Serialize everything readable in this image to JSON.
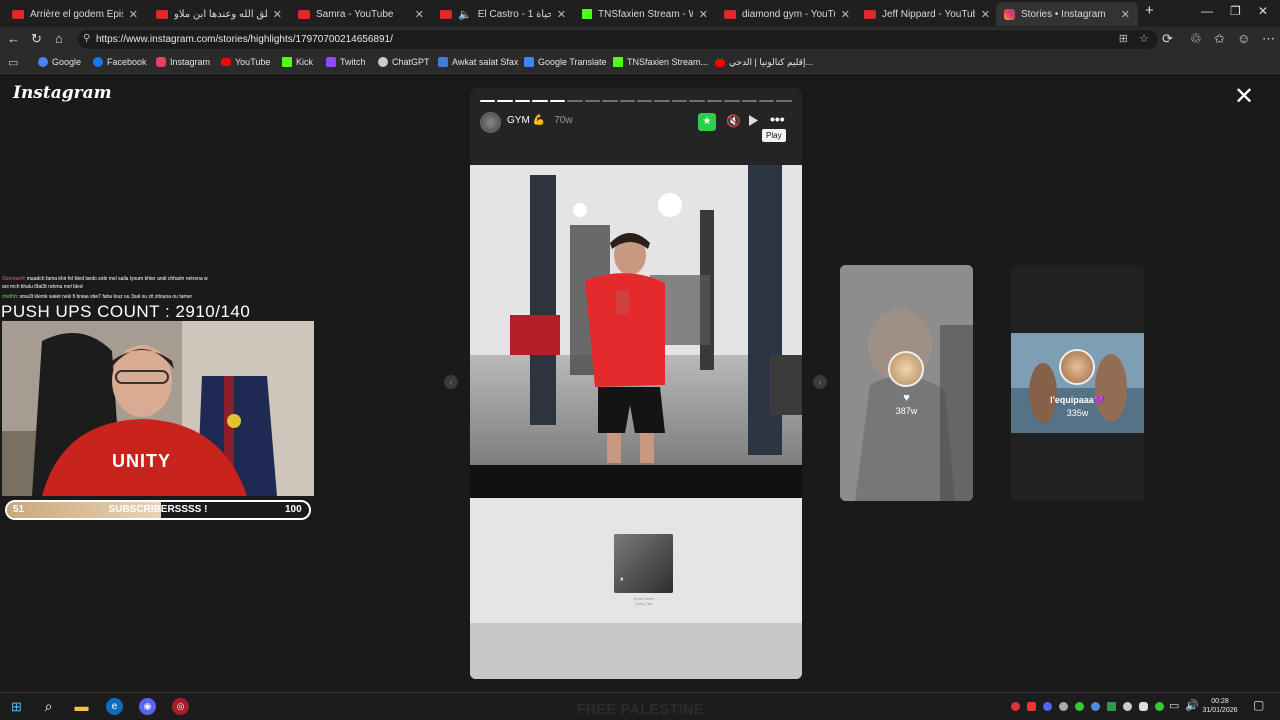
{
  "browser": {
    "tabs": [
      {
        "title": "Arrière el godem Épisode 05",
        "icon": "youtube-icon"
      },
      {
        "title": "أطيب خلق الله وعندها أبن ملاو",
        "icon": "youtube-icon"
      },
      {
        "title": "Samra - YouTube",
        "icon": "youtube-icon"
      },
      {
        "title": "El Castro - 1 فلسفة الحياة",
        "icon": "youtube-icon"
      },
      {
        "title": "TNSfaxien Stream - Watch Li",
        "icon": "kick-icon"
      },
      {
        "title": "diamond gym - YouTube",
        "icon": "youtube-icon"
      },
      {
        "title": "Jeff Nippard - YouTube",
        "icon": "youtube-icon"
      },
      {
        "title": "Stories • Instagram",
        "icon": "instagram-icon"
      }
    ],
    "new_tab": "+",
    "url": "https://www.instagram.com/stories/highlights/17970700214656891/",
    "bookmarks": [
      {
        "label": "Google",
        "color": "#4285f4"
      },
      {
        "label": "Facebook",
        "color": "#1877f2"
      },
      {
        "label": "Instagram",
        "color": "#e4405f"
      },
      {
        "label": "YouTube",
        "color": "#ff0000"
      },
      {
        "label": "Kick",
        "color": "#53fc18"
      },
      {
        "label": "Twitch",
        "color": "#9146ff"
      },
      {
        "label": "ChatGPT",
        "color": "#cccccc"
      },
      {
        "label": "Awkat salat Sfax",
        "color": "#3b7fd9"
      },
      {
        "label": "Google Translate",
        "color": "#4285f4"
      },
      {
        "label": "TNSfaxien Stream...",
        "color": "#53fc18"
      },
      {
        "label": "إقليم كتالونيا | الدحي...",
        "color": "#ff0000"
      }
    ]
  },
  "instagram": {
    "logo": "Instagram",
    "story": {
      "username": "GYM",
      "emoji": "💪",
      "age": "70w",
      "tooltip": "Play",
      "progress_total": 18,
      "progress_done": 5,
      "music_caption_1": "Artist Name",
      "music_caption_2": "Song Title"
    },
    "side_stories": [
      {
        "caption": "",
        "age": "387w"
      },
      {
        "caption": "l'equipaaa💜",
        "age": "335w"
      }
    ]
  },
  "stream_overlay": {
    "chat": [
      {
        "user": "l3amouri4",
        "message": ": maadch fama khir fel bled tardo zebi mel salla lyoum khter andi chharin netrena w"
      },
      {
        "user": "",
        "message": "ani mch khalu t9at3t rahma mel bled"
      },
      {
        "user": "chelhb",
        "message": ": sma3t klemk walet neki fi bniaa sbe7 faha louz ou 3sal ou zit zitouna ou tamer"
      }
    ],
    "pushups": "PUSH UPS COUNT : 2910/140",
    "jersey_text": "UNITY",
    "subs": {
      "current": "51",
      "label": "SUBSCRIBERSSSS !",
      "goal": "100",
      "progress_pct": 51
    }
  },
  "taskbar": {
    "time": "00:28",
    "date": "31/01/2026",
    "ghost_text": "FREE PALESTINE"
  }
}
